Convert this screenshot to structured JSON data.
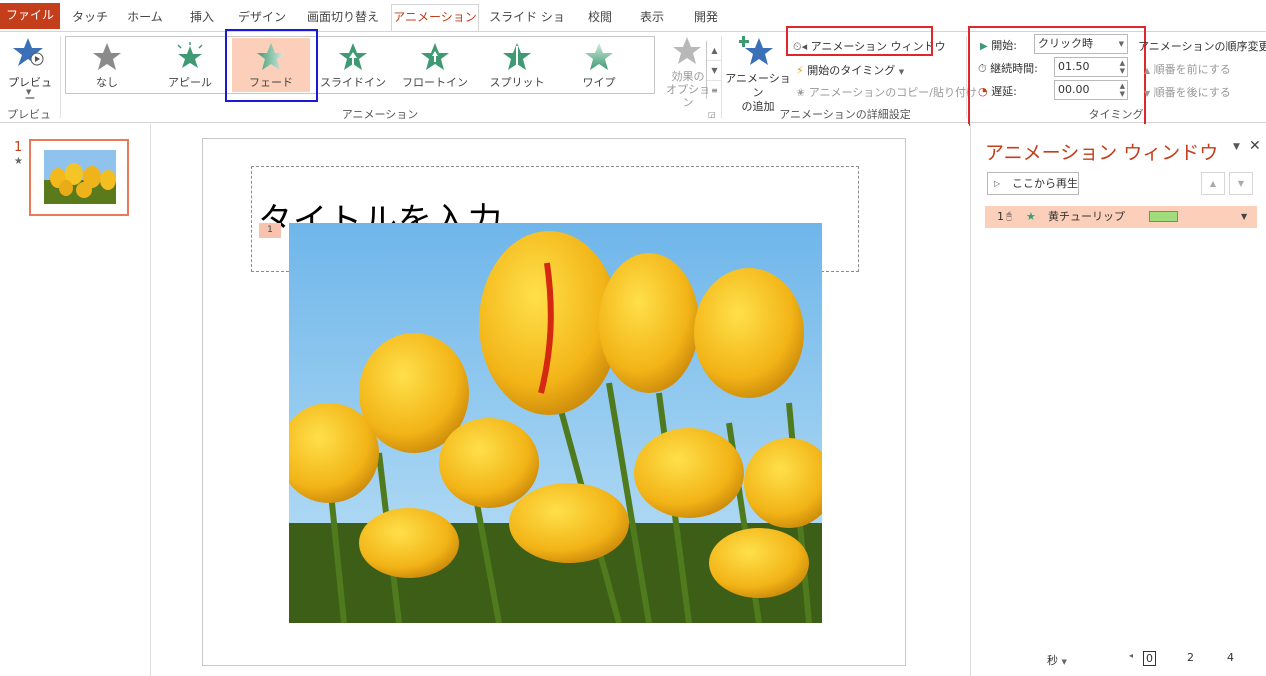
{
  "tabs": [
    "ファイル",
    "タッチ",
    "ホーム",
    "挿入",
    "デザイン",
    "画面切り替え",
    "アニメーション",
    "スライド ショー",
    "校閲",
    "表示",
    "開発"
  ],
  "preview": {
    "label": "プレビュー",
    "group": "プレビュー"
  },
  "gallery": {
    "items": [
      "なし",
      "アピール",
      "フェード",
      "スライドイン",
      "フロートイン",
      "スプリット",
      "ワイプ"
    ],
    "selected": "フェード",
    "effect_options": "効果の\nオプション",
    "group": "アニメーション"
  },
  "advanced": {
    "add_animation": "アニメーション\nの追加",
    "anim_window": "アニメーション ウィンドウ",
    "trigger": "開始のタイミング",
    "painter": "アニメーションのコピー/貼り付け",
    "group": "アニメーションの詳細設定"
  },
  "timing": {
    "start_label": "開始:",
    "start_value": "クリック時",
    "duration_label": "継続時間:",
    "duration_value": "01.50",
    "delay_label": "遅延:",
    "delay_value": "00.00",
    "group": "タイミング",
    "reorder": "アニメーションの順序変更",
    "move_earlier": "順番を前にする",
    "move_later": "順番を後にする"
  },
  "thumbnail": {
    "number": "1",
    "star": "★"
  },
  "slide": {
    "title": "タイトルを入力",
    "anim_tag": "1"
  },
  "anim_pane": {
    "title": "アニメーション ウィンドウ",
    "play_button": "ここから再生",
    "item_number": "1",
    "item_name": "黄チューリップ",
    "seconds": "秒",
    "timeline": [
      "0",
      "2",
      "4"
    ]
  },
  "colors": {
    "accent": "#c43e1c",
    "selected": "#fbcfb9",
    "bar": "#9edc7c",
    "red_box": "#e0262d",
    "blue_box": "#1a1ad6"
  }
}
